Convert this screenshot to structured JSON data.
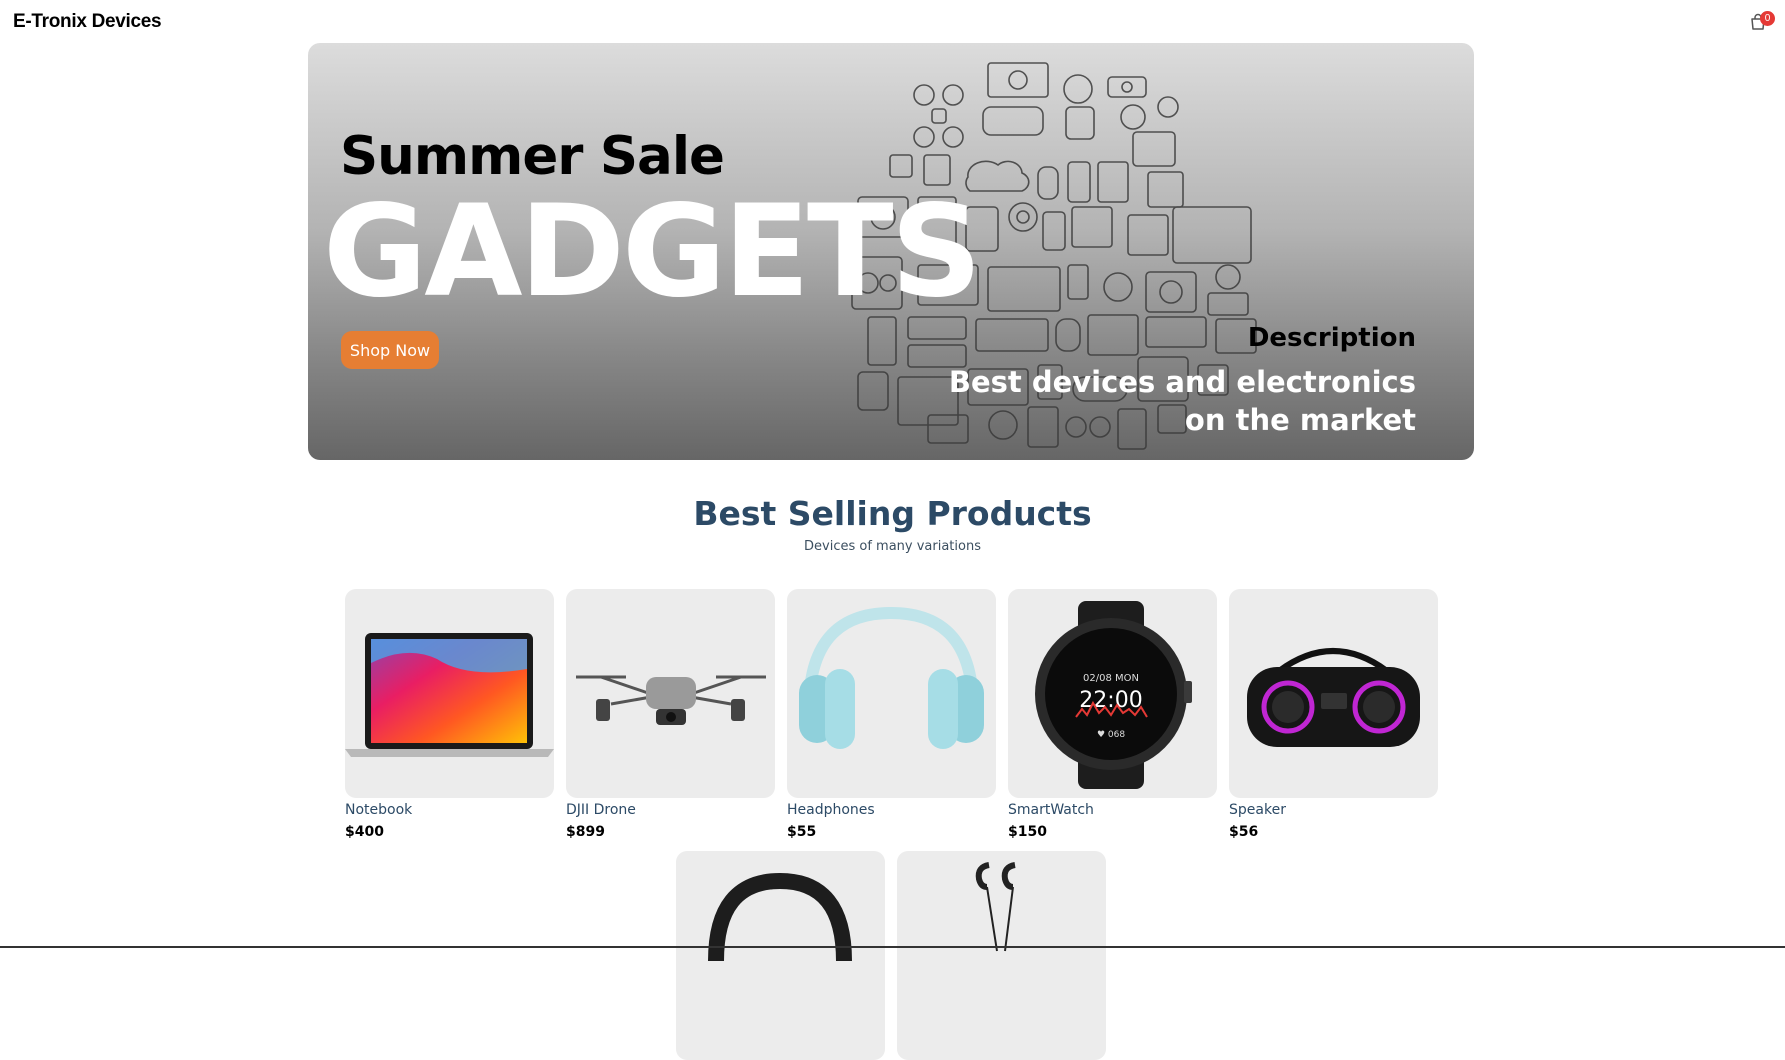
{
  "header": {
    "brand": "E-Tronix Devices",
    "cart_icon": "shopping-bag-icon",
    "cart_count": "0"
  },
  "hero": {
    "kicker": "Summer Sale",
    "headline": "GADGETS",
    "cta_label": "Shop Now",
    "description_title": "Description",
    "description_text": "Best devices and electronics on the market",
    "art_icon": "electronics-icon-collage"
  },
  "products_section": {
    "title": "Best Selling Products",
    "subtitle": "Devices of many variations"
  },
  "products": [
    {
      "name": "Notebook",
      "price": "$400",
      "image_icon": "laptop-icon"
    },
    {
      "name": "DJII Drone",
      "price": "$899",
      "image_icon": "drone-icon"
    },
    {
      "name": "Headphones",
      "price": "$55",
      "image_icon": "headphones-icon"
    },
    {
      "name": "SmartWatch",
      "price": "$150",
      "image_icon": "smartwatch-icon"
    },
    {
      "name": "Speaker",
      "price": "$56",
      "image_icon": "speaker-icon"
    }
  ],
  "products_partial": [
    {
      "image_icon": "neckband-headphones-icon"
    },
    {
      "image_icon": "earphones-icon"
    }
  ],
  "colors": {
    "cta": "#e67e33",
    "heading": "#2c4a66",
    "badge": "#e53935"
  }
}
